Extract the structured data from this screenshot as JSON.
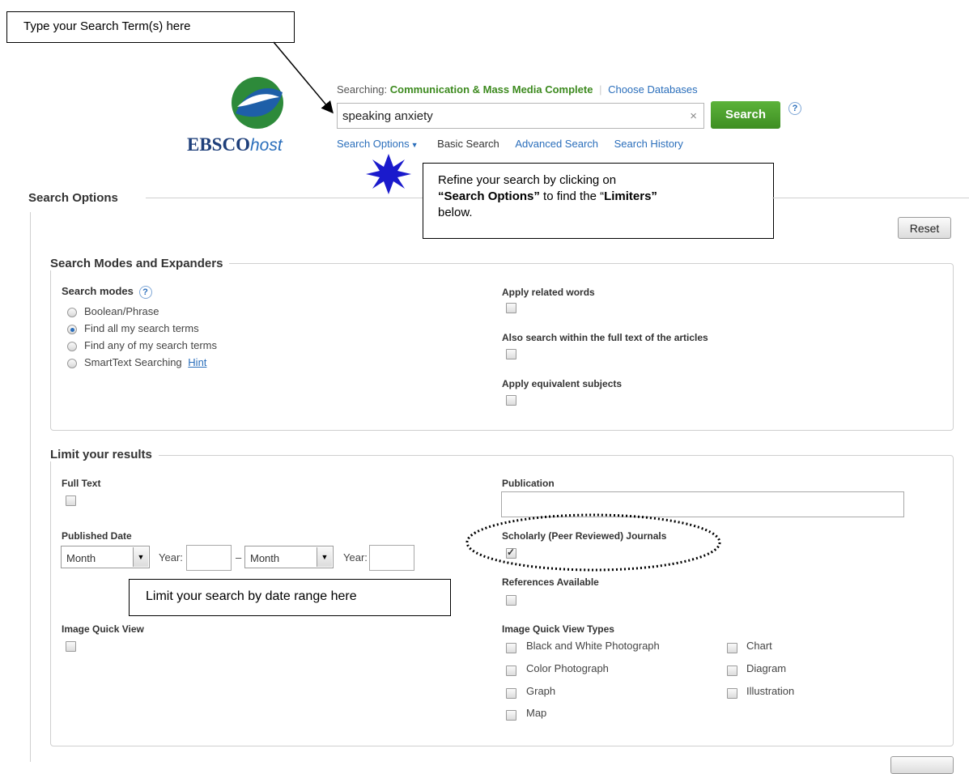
{
  "callouts": {
    "search_term": "Type your Search Term(s) here",
    "refine_line1": "Refine your search by clicking on",
    "refine_line2_bold": "“Search Options”",
    "refine_line2_rest": " to find the “",
    "refine_line2_bold2": "Limiters”",
    "refine_line3": "below.",
    "date_range": "Limit your search by date range here"
  },
  "header": {
    "logo_bold": "EBSCO",
    "logo_italic": "host",
    "searching_label": "Searching:",
    "database": "Communication & Mass Media Complete",
    "choose_databases": "Choose Databases",
    "search_value": "speaking anxiety",
    "clear": "×",
    "search_button": "Search",
    "help": "?",
    "nav": {
      "search_options": "Search Options",
      "basic_search": "Basic Search",
      "advanced_search": "Advanced Search",
      "search_history": "Search History"
    }
  },
  "search_options": {
    "title": "Search Options",
    "reset": "Reset",
    "modes_section": {
      "title": "Search Modes and Expanders",
      "search_modes_label": "Search modes",
      "help": "?",
      "modes": [
        "Boolean/Phrase",
        "Find all my search terms",
        "Find any of my search terms",
        "SmartText Searching"
      ],
      "selected_mode": 1,
      "hint": "Hint",
      "apply_related_words": "Apply related words",
      "full_text_search": "Also search within the full text of the articles",
      "apply_equivalent_subjects": "Apply equivalent subjects"
    },
    "limits_section": {
      "title": "Limit your results",
      "full_text": "Full Text",
      "published_date": "Published Date",
      "month_from": "Month",
      "year_label_1": "Year:",
      "dash": "–",
      "month_to": "Month",
      "year_label_2": "Year:",
      "image_quick_view": "Image Quick View",
      "publication": "Publication",
      "scholarly": "Scholarly (Peer Reviewed) Journals",
      "scholarly_checked": true,
      "references_available": "References Available",
      "image_quick_view_types": "Image Quick View Types",
      "types_col1": [
        "Black and White Photograph",
        "Color Photograph",
        "Graph",
        "Map"
      ],
      "types_col2": [
        "Chart",
        "Diagram",
        "Illustration"
      ]
    }
  },
  "colors": {
    "green": "#4a9c2d",
    "link": "#2a6ebb",
    "db_green": "#3d8a1f",
    "star": "#1a1acc"
  }
}
